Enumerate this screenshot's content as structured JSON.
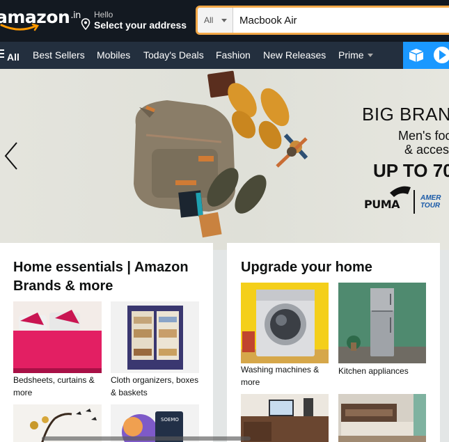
{
  "header": {
    "logo_text": "amazon",
    "logo_tld": ".in",
    "deliver_hello": "Hello",
    "deliver_address": "Select your address",
    "search": {
      "department": "All",
      "value": "Macbook Air"
    }
  },
  "nav": {
    "all": "All",
    "items": [
      "Best Sellers",
      "Mobiles",
      "Today's Deals",
      "Fashion",
      "New Releases",
      "Prime"
    ]
  },
  "hero": {
    "line1": "BIG BRAN",
    "line2": "Men's foo",
    "line3": "& access",
    "line4": "UP TO 70",
    "brand1": "PUMA",
    "brand2_line1": "AMER",
    "brand2_line2": "TOUR"
  },
  "cards": [
    {
      "title": "Home essentials | Amazon Brands & more",
      "tiles": [
        {
          "caption": "Bedsheets, curtains & more"
        },
        {
          "caption": "Cloth organizers, boxes & baskets"
        }
      ]
    },
    {
      "title": "Upgrade your home",
      "tiles": [
        {
          "caption": "Washing machines & more"
        },
        {
          "caption": "Kitchen appliances"
        }
      ]
    }
  ],
  "colors": {
    "topbar": "#131921",
    "subnav": "#232f3e",
    "search_border": "#f3a847",
    "accent_orange": "#ff9900",
    "promo_blue": "#1a98ff"
  }
}
